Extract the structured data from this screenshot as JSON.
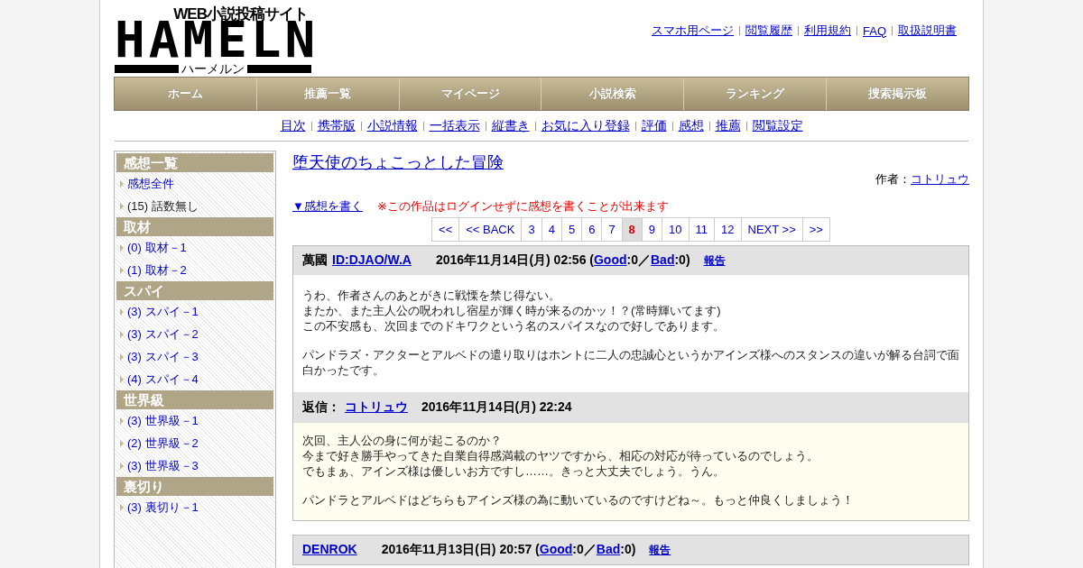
{
  "logo": {
    "tagline": "WEB小説投稿サイト",
    "name": "HAMELN",
    "kana": "ハーメルン"
  },
  "top_links": [
    "スマホ用ページ",
    "閲覧履歴",
    "利用規約",
    "FAQ",
    "取扱説明書"
  ],
  "nav": [
    "ホーム",
    "推薦一覧",
    "マイページ",
    "小説検索",
    "ランキング",
    "捜索掲示板"
  ],
  "sub_links": [
    "目次",
    "携帯版",
    "小説情報",
    "一括表示",
    "縦書き",
    "お気に入り登録",
    "評価",
    "感想",
    "推薦",
    "閲覧設定"
  ],
  "sidebar": [
    {
      "heading": "感想一覧",
      "items": [
        {
          "text": "感想全件",
          "link": true
        },
        {
          "text": "(15) 話数無し",
          "link": false
        }
      ]
    },
    {
      "heading": "取材",
      "items": [
        {
          "text": "(0) 取材－1",
          "link": true
        },
        {
          "text": "(1) 取材－2",
          "link": true
        }
      ]
    },
    {
      "heading": "スパイ",
      "items": [
        {
          "text": "(3) スパイ－1",
          "link": true
        },
        {
          "text": "(3) スパイ－2",
          "link": true
        },
        {
          "text": "(3) スパイ－3",
          "link": true
        },
        {
          "text": "(4) スパイ－4",
          "link": true
        }
      ]
    },
    {
      "heading": "世界級",
      "items": [
        {
          "text": "(3) 世界級－1",
          "link": true
        },
        {
          "text": "(2) 世界級－2",
          "link": true
        },
        {
          "text": "(3) 世界級－3",
          "link": true
        }
      ]
    },
    {
      "heading": "裏切り",
      "items": [
        {
          "text": "(3) 裏切り－1",
          "link": true
        }
      ]
    }
  ],
  "novel_title": "堕天使のちょこっとした冒険",
  "author_label": "作者：",
  "author": "コトリュウ",
  "write_link": "▼感想を書く",
  "notice": "※この作品はログインせずに感想を書くことが出来ます",
  "pages": [
    {
      "label": "<<",
      "selected": false
    },
    {
      "label": "<< BACK",
      "selected": false
    },
    {
      "label": "3",
      "selected": false
    },
    {
      "label": "4",
      "selected": false
    },
    {
      "label": "5",
      "selected": false
    },
    {
      "label": "6",
      "selected": false
    },
    {
      "label": "7",
      "selected": false
    },
    {
      "label": "8",
      "selected": true
    },
    {
      "label": "9",
      "selected": false
    },
    {
      "label": "10",
      "selected": false
    },
    {
      "label": "11",
      "selected": false
    },
    {
      "label": "12",
      "selected": false
    },
    {
      "label": "NEXT >>",
      "selected": false
    },
    {
      "label": ">>",
      "selected": false
    }
  ],
  "comments": [
    {
      "author": "萬國",
      "author_link": "ID:DJAO/W.A",
      "meta": [
        {
          "kind": "text",
          "text": "2016年11月14日(月) 02:56 ("
        },
        {
          "kind": "link",
          "text": "Good"
        },
        {
          "kind": "text",
          "text": ":0／"
        },
        {
          "kind": "link",
          "text": "Bad"
        },
        {
          "kind": "text",
          "text": ":0)"
        }
      ],
      "report": "報告",
      "body": [
        [
          "うわ、作者さんのあとがきに戦慄を禁じ得ない。",
          "またか、また主人公の呪われし宿星が輝く時が来るのかッ！？(常時輝いてます)",
          "この不安感も、次回までのドキワクという名のスパイスなので好しであります。"
        ],
        [
          "パンドラズ・アクターとアルベドの遣り取りはホントに二人の忠誠心というかアインズ様へのスタンスの違いが解る台詞で面白かったです。"
        ]
      ],
      "reply": {
        "label": "返信：",
        "author": "コトリュウ",
        "date": "2016年11月14日(月) 22:24",
        "body": [
          [
            "次回、主人公の身に何が起こるのか？",
            "今まで好き勝手やってきた自業自得感満載のヤツですから、相応の対応が待っているのでしょう。",
            "でもまぁ、アインズ様は優しいお方ですし……。きっと大丈夫でしょう。うん。"
          ],
          [
            "パンドラとアルベドはどちらもアインズ様の為に動いているのですけどね～。もっと仲良くしましょう！"
          ]
        ]
      }
    },
    {
      "author_link": "DENROK",
      "meta": [
        {
          "kind": "text",
          "text": "2016年11月13日(日) 20:57 ("
        },
        {
          "kind": "link",
          "text": "Good"
        },
        {
          "kind": "text",
          "text": ":0／"
        },
        {
          "kind": "link",
          "text": "Bad"
        },
        {
          "kind": "text",
          "text": ":0)"
        }
      ],
      "report": "報告"
    }
  ]
}
